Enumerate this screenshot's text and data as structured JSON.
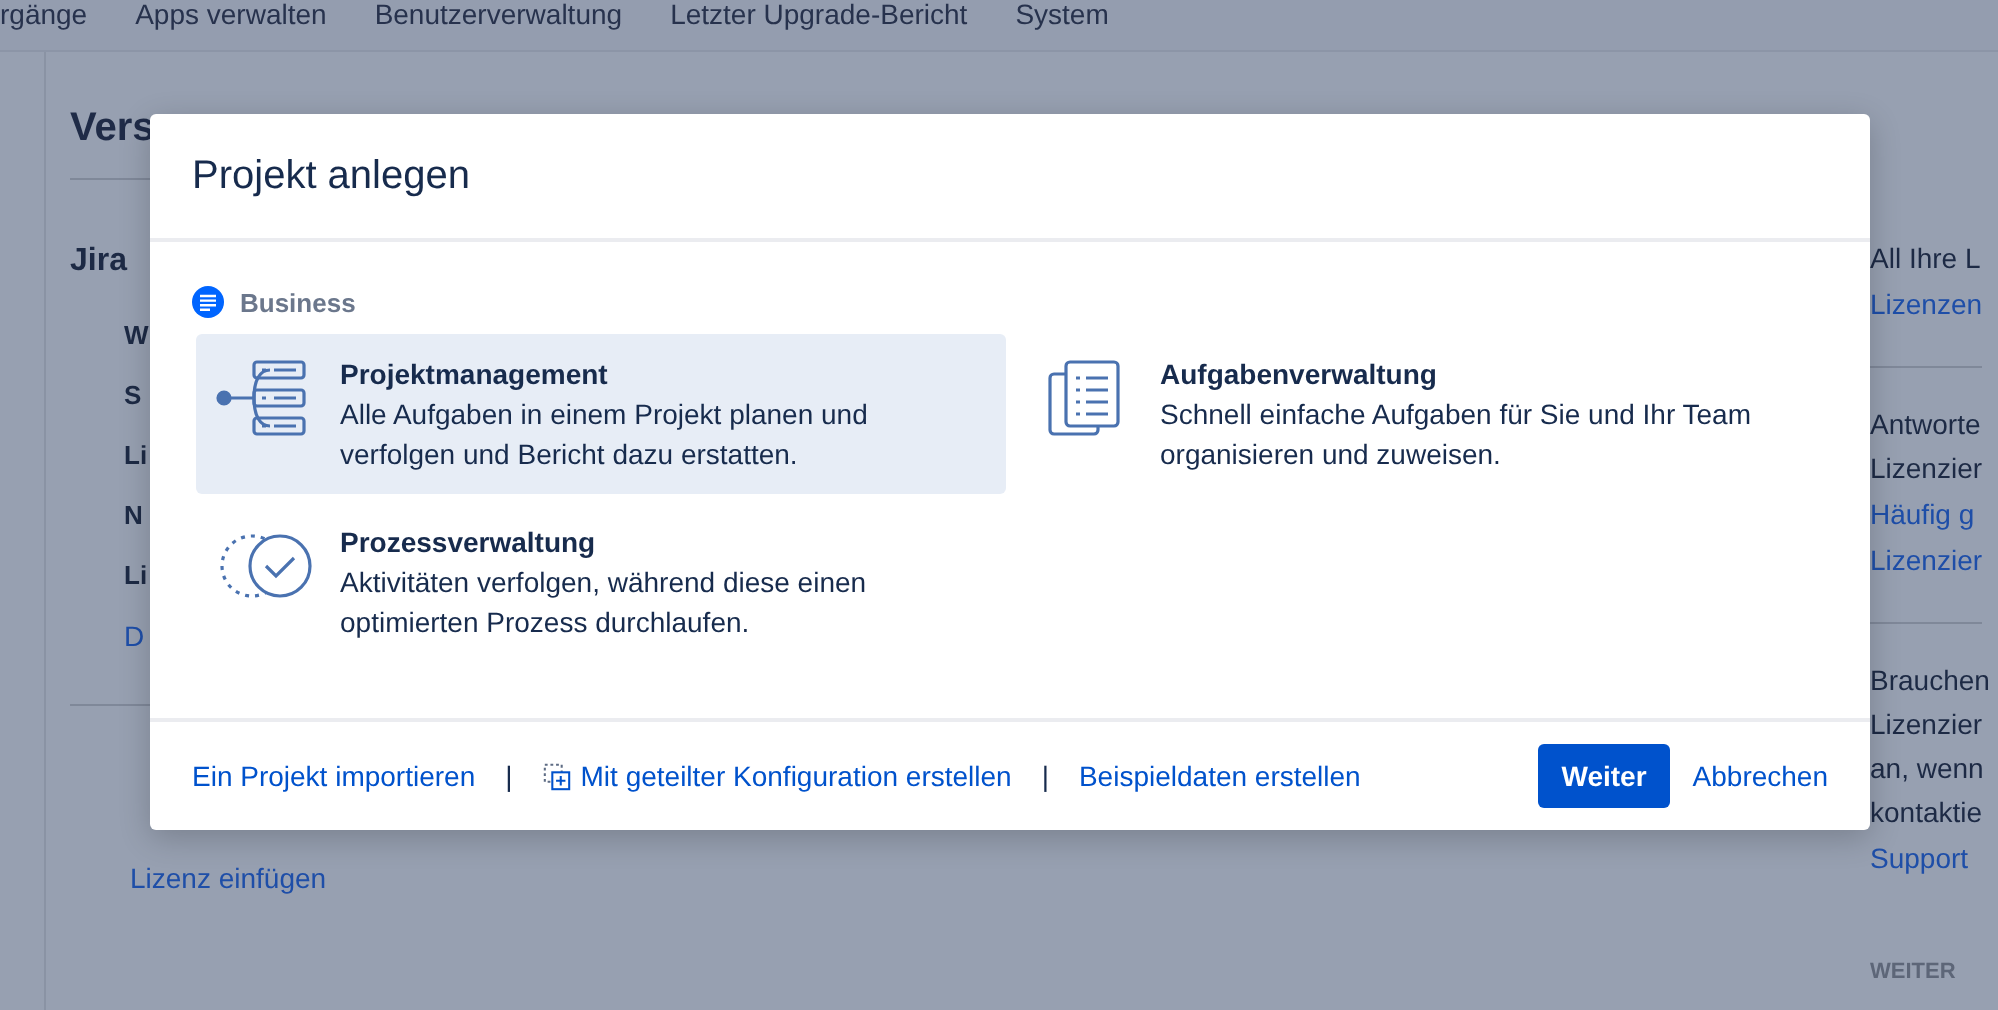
{
  "nav": {
    "items": [
      {
        "label": "rgänge"
      },
      {
        "label": "Apps verwalten"
      },
      {
        "label": "Benutzerverwaltung"
      },
      {
        "label": "Letzter Upgrade-Bericht"
      },
      {
        "label": "System"
      }
    ]
  },
  "page": {
    "heading": "Vers",
    "section_title": "Jira",
    "rows": [
      "W",
      "S",
      "Li",
      "N",
      "Li"
    ],
    "row_link": "D",
    "license_link": "Lizenz einfügen"
  },
  "sidebar": {
    "blocks": [
      {
        "lines": [
          {
            "text": "All Ihre L",
            "kind": "text"
          },
          {
            "text": "Lizenzen",
            "kind": "link"
          }
        ]
      },
      {
        "lines": [
          {
            "text": "Antworte",
            "kind": "text"
          },
          {
            "text": "Lizenzier",
            "kind": "text"
          },
          {
            "text": "Häufig g",
            "kind": "link"
          },
          {
            "text": "Lizenzier",
            "kind": "link"
          }
        ]
      },
      {
        "lines": [
          {
            "text": "Brauchen",
            "kind": "text"
          },
          {
            "text": "Lizenzier",
            "kind": "text"
          },
          {
            "text": "an, wenn",
            "kind": "text"
          },
          {
            "text": "kontaktie",
            "kind": "text"
          },
          {
            "text": "Support",
            "kind": "link"
          }
        ]
      }
    ],
    "footer_label": "WEITER"
  },
  "modal": {
    "title": "Projekt anlegen",
    "category": {
      "label": "Business"
    },
    "options": [
      {
        "kind": "project-management",
        "title": "Projektmanagement",
        "description": "Alle Aufgaben in einem Projekt planen und verfolgen und Bericht dazu erstatten.",
        "selected": true
      },
      {
        "kind": "task",
        "title": "Aufgabenverwaltung",
        "description": "Schnell einfache Aufgaben für Sie und Ihr Team organisieren und zuweisen.",
        "selected": false
      },
      {
        "kind": "process",
        "title": "Prozessverwaltung",
        "description": "Aktivitäten verfolgen, während diese einen optimierten Prozess durchlaufen.",
        "selected": false
      }
    ],
    "footer_links": [
      {
        "label": "Ein Projekt importieren",
        "icon": false
      },
      {
        "label": "Mit geteilter Konfiguration erstellen",
        "icon": true
      },
      {
        "label": "Beispieldaten erstellen",
        "icon": false
      }
    ],
    "separators": [
      "|",
      "|"
    ],
    "primary_button": "Weiter",
    "cancel_button": "Abbrechen"
  }
}
